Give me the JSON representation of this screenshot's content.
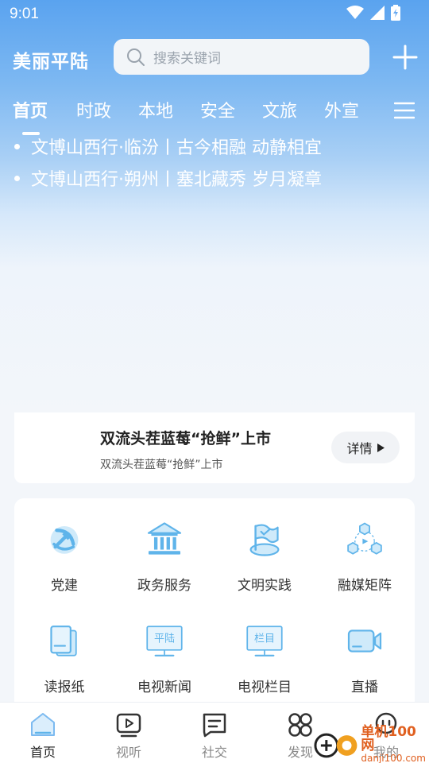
{
  "status": {
    "time": "9:01"
  },
  "header": {
    "logo": "美丽平陆",
    "search_placeholder": "搜索关键词"
  },
  "tabs": [
    "首页",
    "时政",
    "本地",
    "安全",
    "文旅",
    "外宣"
  ],
  "ticker": [
    "文博山西行·临汾丨古今相融 动静相宜",
    "文博山西行·朔州丨塞北藏秀 岁月凝章"
  ],
  "banner": {
    "title": "双流头茬蓝莓“抢鲜”上市",
    "subtitle": "双流头茬蓝莓“抢鲜”上市",
    "detail": "详情"
  },
  "services": [
    {
      "label": "党建",
      "icon": "party-emblem-icon"
    },
    {
      "label": "政务服务",
      "icon": "government-building-icon"
    },
    {
      "label": "文明实践",
      "icon": "flag-icon"
    },
    {
      "label": "融媒矩阵",
      "icon": "media-matrix-icon"
    },
    {
      "label": "读报纸",
      "icon": "newspaper-icon"
    },
    {
      "label": "电视新闻",
      "icon": "tv-news-icon"
    },
    {
      "label": "电视栏目",
      "icon": "tv-column-icon"
    },
    {
      "label": "直播",
      "icon": "live-camera-icon"
    }
  ],
  "tv_screens": {
    "news": "平陆",
    "column": "栏目"
  },
  "bottom_nav": [
    "首页",
    "视听",
    "社交",
    "发现",
    "我的"
  ],
  "watermark": {
    "title": "单机100网",
    "site": "danji100.com"
  },
  "colors": {
    "accent": "#5fb4ea",
    "hero_top": "#5aa3ef",
    "watermark": "#e06020"
  }
}
